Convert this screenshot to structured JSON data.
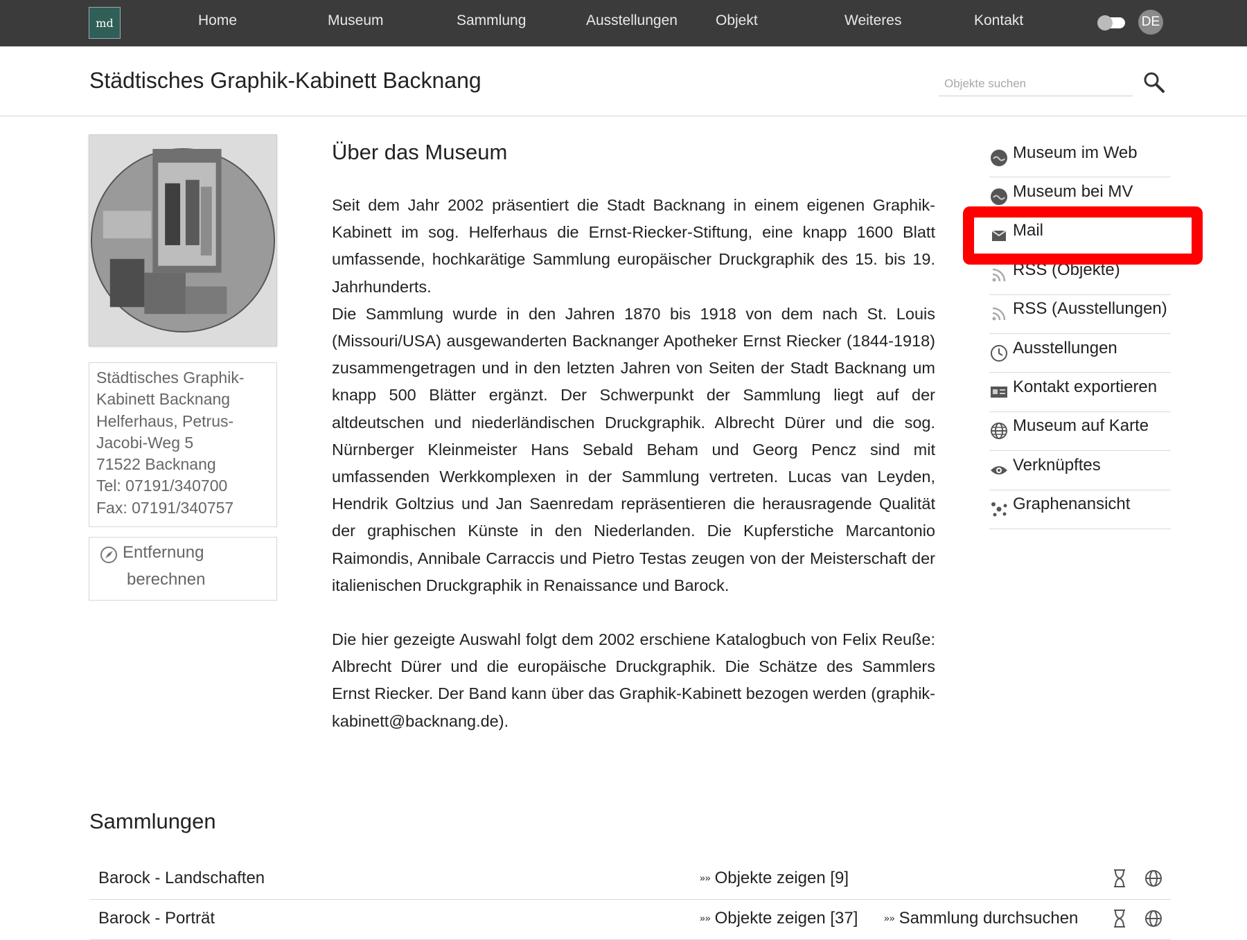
{
  "nav": {
    "logo_text": "md",
    "items": [
      {
        "label": "Home"
      },
      {
        "label": "Museum"
      },
      {
        "label": "Sammlung"
      },
      {
        "label": "Ausstellungen"
      },
      {
        "label": "Objekt"
      },
      {
        "label": "Weiteres"
      },
      {
        "label": "Kontakt"
      }
    ],
    "language": "DE"
  },
  "header": {
    "title": "Städtisches Graphik-Kabinett Backnang",
    "search_placeholder": "Objekte suchen"
  },
  "address": {
    "lines": [
      "Städtisches Graphik-",
      "Kabinett Backnang",
      "Helferhaus, Petrus-",
      "Jacobi-Weg 5",
      "71522 Backnang",
      "Tel: 07191/340700",
      "Fax: 07191/340757"
    ],
    "distance_line1": "Entfernung",
    "distance_line2": "berechnen"
  },
  "about": {
    "heading": "Über das Museum",
    "paragraphs": [
      "Seit dem Jahr 2002 präsentiert die Stadt Backnang in einem eigenen Graphik-Kabinett im sog. Helferhaus die Ernst-Riecker-Stiftung, eine knapp 1600 Blatt umfassende, hochkarätige Sammlung europäischer Druckgraphik des 15. bis 19. Jahrhunderts.",
      "Die Sammlung wurde in den Jahren 1870 bis 1918 von dem nach St. Louis (Missouri/USA) ausgewanderten Backnanger Apotheker Ernst Riecker (1844-1918) zusammengetragen und in den letzten Jahren von Seiten der Stadt Backnang um knapp 500 Blätter ergänzt. Der Schwerpunkt der Sammlung liegt auf der altdeutschen und niederländischen Druckgraphik. Albrecht Dürer und die sog. Nürnberger Kleinmeister Hans Sebald Beham und Georg Pencz sind mit umfassenden Werkkomplexen in der Sammlung vertreten. Lucas van Leyden, Hendrik Goltzius und Jan Saenredam repräsentieren die herausragende Qualität der graphischen Künste in den Niederlanden. Die Kupferstiche Marcantonio Raimondis, Annibale Carraccis und Pietro Testas zeugen von der Meisterschaft der italienischen Druckgraphik in Renaissance und Barock.",
      "Die hier gezeigte Auswahl folgt dem 2002 erschiene Katalogbuch von Felix Reuße: Albrecht Dürer und die europäische Druckgraphik. Die Schätze des Sammlers Ernst Riecker. Der Band kann über das Graphik-Kabinett bezogen werden (graphik-kabinett@backnang.de)."
    ]
  },
  "sidebar": {
    "items": [
      {
        "label": "Museum im Web",
        "icon": "web-icon"
      },
      {
        "label": "Museum bei MV",
        "icon": "mv-icon"
      },
      {
        "label": "Mail",
        "icon": "mail-icon"
      },
      {
        "label": "RSS (Objekte)",
        "icon": "rss-icon"
      },
      {
        "label": "RSS (Ausstellungen)",
        "icon": "rss-icon"
      },
      {
        "label": "Ausstellungen",
        "icon": "clock-icon"
      },
      {
        "label": "Kontakt exportieren",
        "icon": "contact-card-icon"
      },
      {
        "label": "Museum auf Karte",
        "icon": "globe-icon"
      },
      {
        "label": "Verknüpftes",
        "icon": "eye-icon"
      },
      {
        "label": "Graphenansicht",
        "icon": "graph-icon"
      }
    ],
    "highlighted": "Mail"
  },
  "collections": {
    "heading": "Sammlungen",
    "rows": [
      {
        "name": "Barock - Landschaften",
        "show": "Objekte zeigen [9]",
        "search": ""
      },
      {
        "name": "Barock - Porträt",
        "show": "Objekte zeigen [37]",
        "search": "Sammlung durchsuchen"
      }
    ],
    "link_arrow": "»»"
  },
  "colors": {
    "nav_background": "#3b3b3b",
    "logo_background": "#2f5f56",
    "highlight_border": "#ff0000",
    "address_text": "#666666"
  }
}
